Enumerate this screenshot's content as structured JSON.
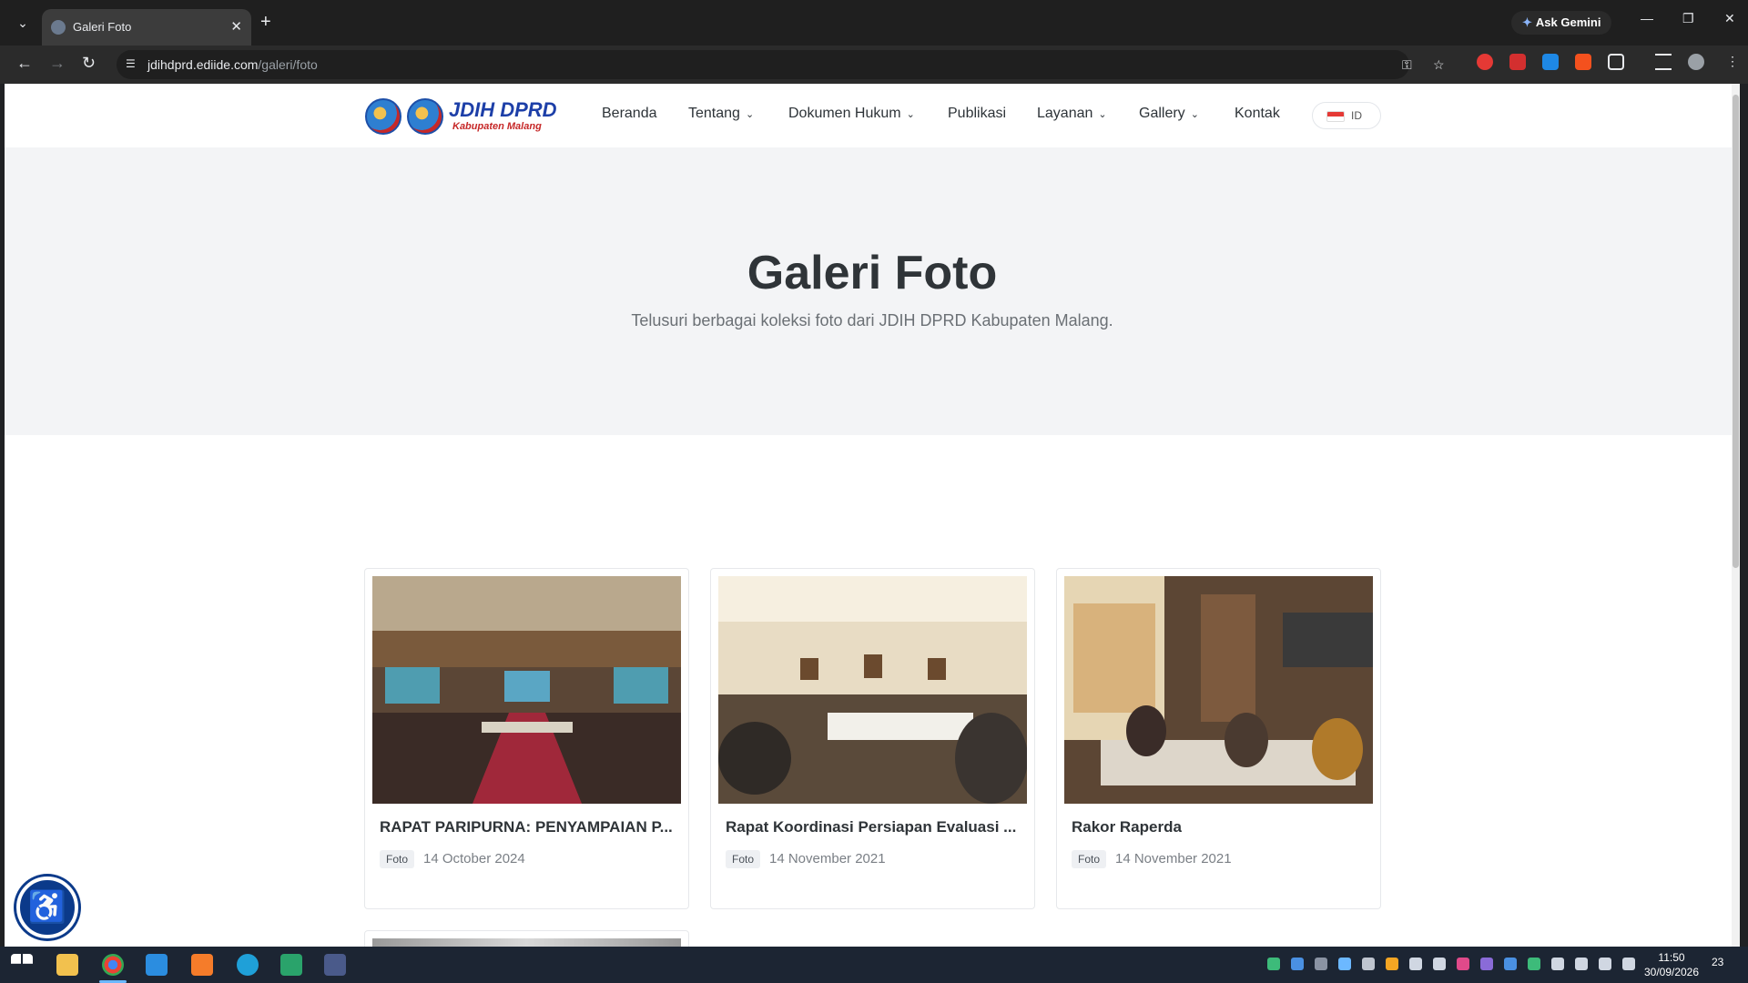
{
  "browser": {
    "tab_title": "Galeri Foto",
    "tab_close": "✕",
    "new_tab": "+",
    "gemini_label": "Ask Gemini",
    "url_host": "jdihdprd.ediide.com",
    "url_path": "/galeri/foto"
  },
  "site": {
    "logo_title": "JDIH DPRD",
    "logo_subtitle": "Kabupaten Malang",
    "nav": {
      "home": "Beranda",
      "about": "Tentang",
      "legal_docs": "Dokumen Hukum",
      "publications": "Publikasi",
      "services": "Layanan",
      "gallery": "Gallery",
      "contact": "Kontak"
    },
    "lang_code": "ID"
  },
  "hero": {
    "title": "Galeri Foto",
    "subtitle": "Telusuri berbagai koleksi foto dari JDIH DPRD Kabupaten Malang."
  },
  "gallery": {
    "items": [
      {
        "title": "RAPAT PARIPURNA: PENYAMPAIAN P...",
        "category": "Foto",
        "date": "14 October 2024"
      },
      {
        "title": "Rapat Koordinasi Persiapan Evaluasi ...",
        "category": "Foto",
        "date": "14 November 2021"
      },
      {
        "title": "Rakor Raperda",
        "category": "Foto",
        "date": "14 November 2021"
      }
    ]
  },
  "taskbar": {
    "time": "11:50",
    "date": "30/09/2026",
    "notification_count": "23"
  },
  "colors": {
    "brand_blue": "#1d3fa8",
    "brand_red": "#c62828",
    "hero_bg": "#f3f4f6",
    "a11y_button": "#0b3a8a"
  }
}
